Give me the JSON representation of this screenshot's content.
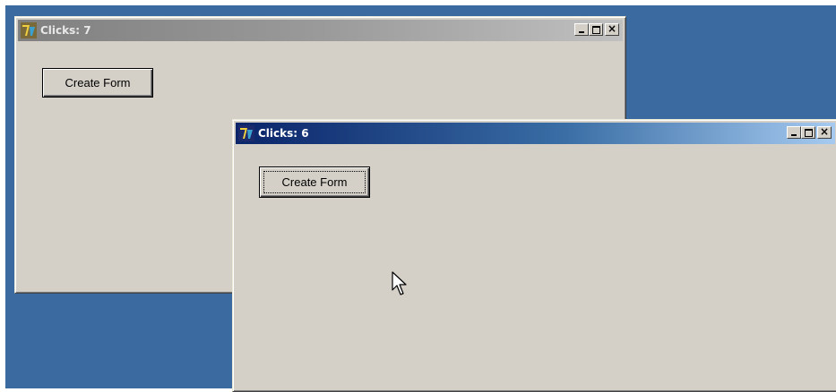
{
  "windows": [
    {
      "title": "Clicks: 7",
      "state": "inactive",
      "button_label": "Create Form"
    },
    {
      "title": "Clicks: 6",
      "state": "active",
      "button_label": "Create Form"
    }
  ],
  "icons": {
    "app": "app-icon",
    "minimize": "minimize-icon",
    "maximize": "maximize-icon",
    "close": "close-icon",
    "cursor": "mouse-pointer-icon"
  },
  "colors": {
    "desktop": "#3b6aa0",
    "window_face": "#d4d0c8",
    "active_title_start": "#0a246a",
    "active_title_end": "#a6caf0",
    "inactive_title": "#808080"
  }
}
